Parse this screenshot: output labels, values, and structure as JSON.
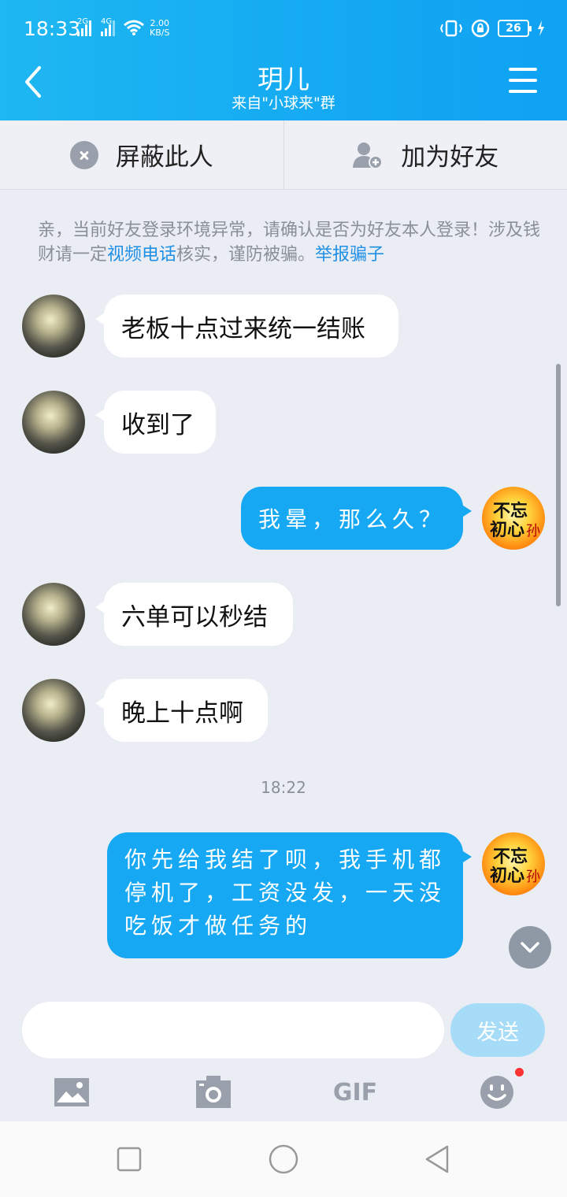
{
  "status_bar": {
    "time": "18:33",
    "signal1_label": "2G",
    "signal2_label": "4G",
    "net_speed_value": "2.00",
    "net_speed_unit": "KB/S",
    "battery": "26"
  },
  "header": {
    "title": "玥儿",
    "subtitle": "来自\"小球来\"群",
    "accent_color": "#14a9f2"
  },
  "actions": {
    "block_label": "屏蔽此人",
    "add_friend_label": "加为好友"
  },
  "notice": {
    "text_1": "亲，当前好友登录环境异常，请确认是否为好友本人登录！涉及钱财请一定",
    "link_video": "视频电话",
    "text_2": "核实，谨防被骗。",
    "link_report": "举报骗子"
  },
  "messages": [
    {
      "side": "in",
      "text": "老板十点过来统一结账"
    },
    {
      "side": "in",
      "text": "收到了"
    },
    {
      "side": "out",
      "text": "我晕，那么久？"
    },
    {
      "side": "in",
      "text": "六单可以秒结"
    },
    {
      "side": "in",
      "text": "晚上十点啊"
    },
    {
      "side": "out",
      "text": "你先给我结了呗，我手机都停机了，工资没发，一天没吃饭才做任务的"
    }
  ],
  "timestamp": "18:22",
  "avatar_right_text": "不忘初心",
  "composer": {
    "input_value": "",
    "send_label": "发送",
    "gif_label": "GIF"
  }
}
